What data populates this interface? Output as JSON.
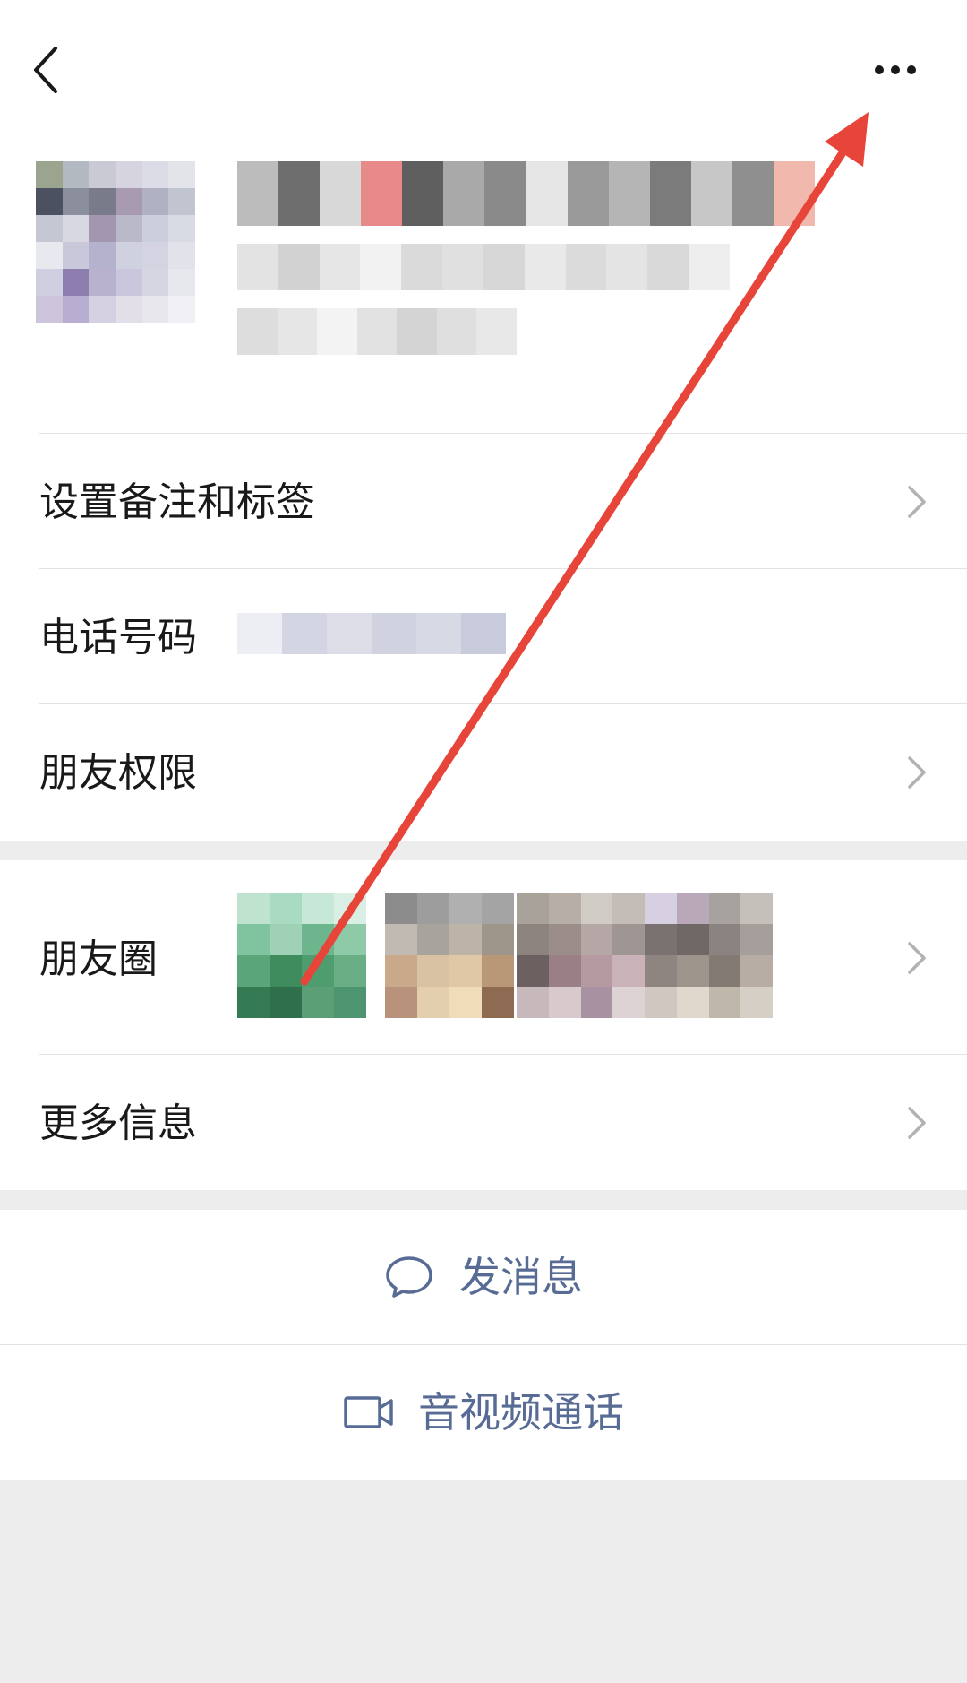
{
  "header": {
    "back_icon": "chevron-left-icon",
    "more_icon": "more-dots-icon"
  },
  "rows": {
    "remark_label": "设置备注和标签",
    "phone_label": "电话号码",
    "permission_label": "朋友权限",
    "moments_label": "朋友圈",
    "more_info_label": "更多信息"
  },
  "actions": {
    "message_label": "发消息",
    "message_icon": "chat-bubble-icon",
    "call_label": "音视频通话",
    "call_icon": "video-camera-icon"
  },
  "annotation": {
    "arrow_color": "#e8453a",
    "arrow_target": "more-dots-icon"
  },
  "colors": {
    "accent_text": "#576b95",
    "background": "#ededed",
    "arrow": "#e8453a"
  }
}
